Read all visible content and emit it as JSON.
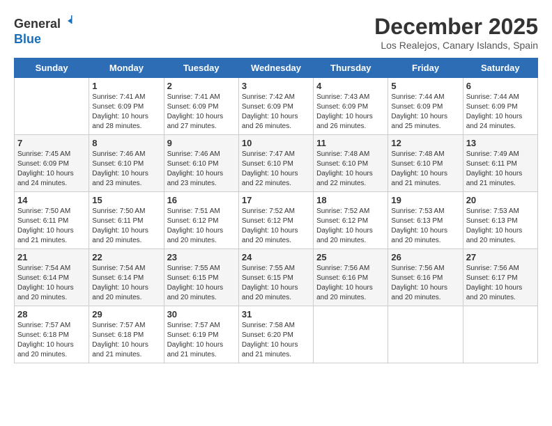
{
  "header": {
    "logo_line1": "General",
    "logo_line2": "Blue",
    "month_title": "December 2025",
    "location": "Los Realejos, Canary Islands, Spain"
  },
  "weekdays": [
    "Sunday",
    "Monday",
    "Tuesday",
    "Wednesday",
    "Thursday",
    "Friday",
    "Saturday"
  ],
  "weeks": [
    [
      {
        "day": "",
        "info": ""
      },
      {
        "day": "1",
        "info": "Sunrise: 7:41 AM\nSunset: 6:09 PM\nDaylight: 10 hours\nand 28 minutes."
      },
      {
        "day": "2",
        "info": "Sunrise: 7:41 AM\nSunset: 6:09 PM\nDaylight: 10 hours\nand 27 minutes."
      },
      {
        "day": "3",
        "info": "Sunrise: 7:42 AM\nSunset: 6:09 PM\nDaylight: 10 hours\nand 26 minutes."
      },
      {
        "day": "4",
        "info": "Sunrise: 7:43 AM\nSunset: 6:09 PM\nDaylight: 10 hours\nand 26 minutes."
      },
      {
        "day": "5",
        "info": "Sunrise: 7:44 AM\nSunset: 6:09 PM\nDaylight: 10 hours\nand 25 minutes."
      },
      {
        "day": "6",
        "info": "Sunrise: 7:44 AM\nSunset: 6:09 PM\nDaylight: 10 hours\nand 24 minutes."
      }
    ],
    [
      {
        "day": "7",
        "info": "Sunrise: 7:45 AM\nSunset: 6:09 PM\nDaylight: 10 hours\nand 24 minutes."
      },
      {
        "day": "8",
        "info": "Sunrise: 7:46 AM\nSunset: 6:10 PM\nDaylight: 10 hours\nand 23 minutes."
      },
      {
        "day": "9",
        "info": "Sunrise: 7:46 AM\nSunset: 6:10 PM\nDaylight: 10 hours\nand 23 minutes."
      },
      {
        "day": "10",
        "info": "Sunrise: 7:47 AM\nSunset: 6:10 PM\nDaylight: 10 hours\nand 22 minutes."
      },
      {
        "day": "11",
        "info": "Sunrise: 7:48 AM\nSunset: 6:10 PM\nDaylight: 10 hours\nand 22 minutes."
      },
      {
        "day": "12",
        "info": "Sunrise: 7:48 AM\nSunset: 6:10 PM\nDaylight: 10 hours\nand 21 minutes."
      },
      {
        "day": "13",
        "info": "Sunrise: 7:49 AM\nSunset: 6:11 PM\nDaylight: 10 hours\nand 21 minutes."
      }
    ],
    [
      {
        "day": "14",
        "info": "Sunrise: 7:50 AM\nSunset: 6:11 PM\nDaylight: 10 hours\nand 21 minutes."
      },
      {
        "day": "15",
        "info": "Sunrise: 7:50 AM\nSunset: 6:11 PM\nDaylight: 10 hours\nand 20 minutes."
      },
      {
        "day": "16",
        "info": "Sunrise: 7:51 AM\nSunset: 6:12 PM\nDaylight: 10 hours\nand 20 minutes."
      },
      {
        "day": "17",
        "info": "Sunrise: 7:52 AM\nSunset: 6:12 PM\nDaylight: 10 hours\nand 20 minutes."
      },
      {
        "day": "18",
        "info": "Sunrise: 7:52 AM\nSunset: 6:12 PM\nDaylight: 10 hours\nand 20 minutes."
      },
      {
        "day": "19",
        "info": "Sunrise: 7:53 AM\nSunset: 6:13 PM\nDaylight: 10 hours\nand 20 minutes."
      },
      {
        "day": "20",
        "info": "Sunrise: 7:53 AM\nSunset: 6:13 PM\nDaylight: 10 hours\nand 20 minutes."
      }
    ],
    [
      {
        "day": "21",
        "info": "Sunrise: 7:54 AM\nSunset: 6:14 PM\nDaylight: 10 hours\nand 20 minutes."
      },
      {
        "day": "22",
        "info": "Sunrise: 7:54 AM\nSunset: 6:14 PM\nDaylight: 10 hours\nand 20 minutes."
      },
      {
        "day": "23",
        "info": "Sunrise: 7:55 AM\nSunset: 6:15 PM\nDaylight: 10 hours\nand 20 minutes."
      },
      {
        "day": "24",
        "info": "Sunrise: 7:55 AM\nSunset: 6:15 PM\nDaylight: 10 hours\nand 20 minutes."
      },
      {
        "day": "25",
        "info": "Sunrise: 7:56 AM\nSunset: 6:16 PM\nDaylight: 10 hours\nand 20 minutes."
      },
      {
        "day": "26",
        "info": "Sunrise: 7:56 AM\nSunset: 6:16 PM\nDaylight: 10 hours\nand 20 minutes."
      },
      {
        "day": "27",
        "info": "Sunrise: 7:56 AM\nSunset: 6:17 PM\nDaylight: 10 hours\nand 20 minutes."
      }
    ],
    [
      {
        "day": "28",
        "info": "Sunrise: 7:57 AM\nSunset: 6:18 PM\nDaylight: 10 hours\nand 20 minutes."
      },
      {
        "day": "29",
        "info": "Sunrise: 7:57 AM\nSunset: 6:18 PM\nDaylight: 10 hours\nand 21 minutes."
      },
      {
        "day": "30",
        "info": "Sunrise: 7:57 AM\nSunset: 6:19 PM\nDaylight: 10 hours\nand 21 minutes."
      },
      {
        "day": "31",
        "info": "Sunrise: 7:58 AM\nSunset: 6:20 PM\nDaylight: 10 hours\nand 21 minutes."
      },
      {
        "day": "",
        "info": ""
      },
      {
        "day": "",
        "info": ""
      },
      {
        "day": "",
        "info": ""
      }
    ]
  ]
}
